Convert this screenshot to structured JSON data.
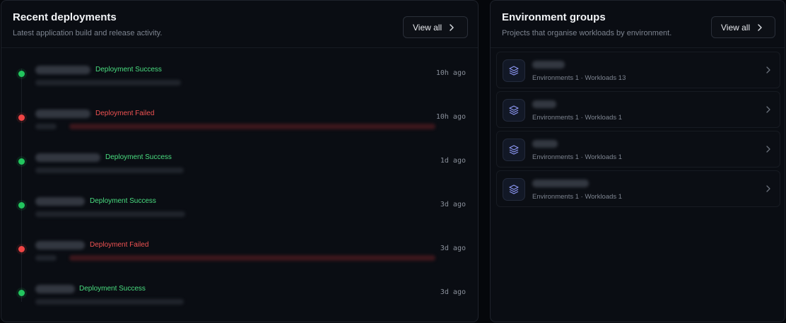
{
  "deployments_panel": {
    "title": "Recent deployments",
    "subtitle": "Latest application build and release activity.",
    "view_all_label": "View all",
    "items": [
      {
        "status": "success",
        "status_label": "Deployment Success",
        "time": "10h ago"
      },
      {
        "status": "failed",
        "status_label": "Deployment Failed",
        "time": "10h ago"
      },
      {
        "status": "success",
        "status_label": "Deployment Success",
        "time": "1d ago"
      },
      {
        "status": "success",
        "status_label": "Deployment Success",
        "time": "3d ago"
      },
      {
        "status": "failed",
        "status_label": "Deployment Failed",
        "time": "3d ago"
      },
      {
        "status": "success",
        "status_label": "Deployment Success",
        "time": "3d ago"
      }
    ]
  },
  "environments_panel": {
    "title": "Environment groups",
    "subtitle": "Projects that organise workloads by environment.",
    "view_all_label": "View all",
    "items": [
      {
        "meta": "Environments 1 · Workloads 13",
        "icon": "layers-icon"
      },
      {
        "meta": "Environments 1 · Workloads 1",
        "icon": "layers-icon"
      },
      {
        "meta": "Environments 1 · Workloads 1",
        "icon": "layers-icon"
      },
      {
        "meta": "Environments 1 · Workloads 1",
        "icon": "layers-icon"
      }
    ]
  },
  "colors": {
    "success": "#22c55e",
    "failed": "#ef4444",
    "accent_icon": "#8b95f0"
  }
}
